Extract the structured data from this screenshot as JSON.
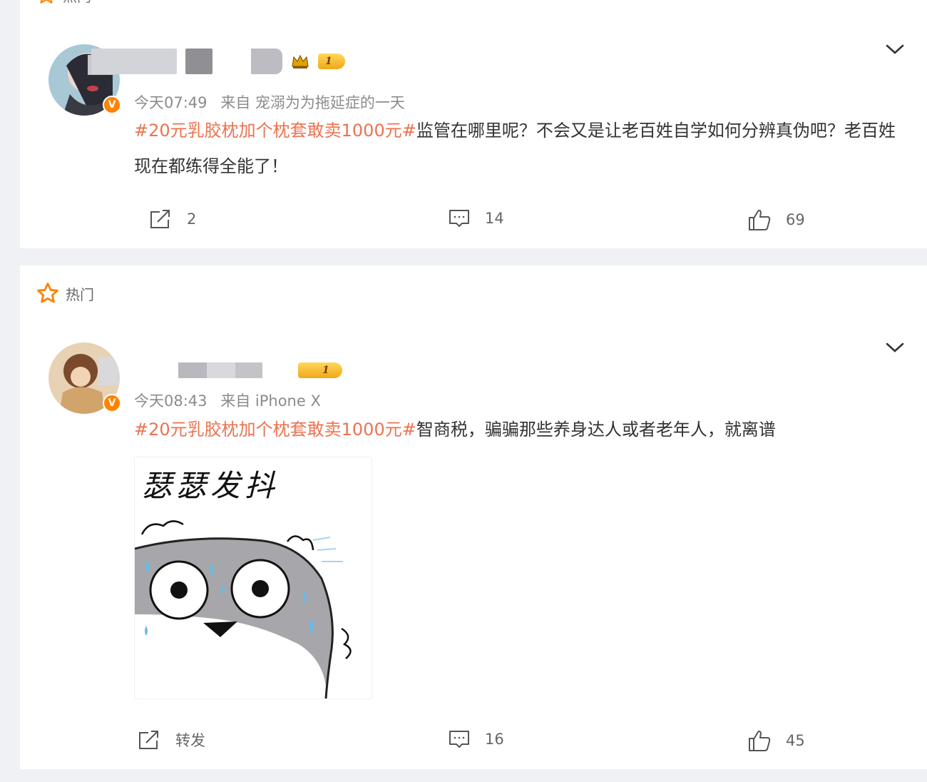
{
  "hot_label": "热门",
  "posts": [
    {
      "time": "今天07:49",
      "source_prefix": "来自",
      "source": "宠溺为为拖延症的一天",
      "level": "1",
      "topic": "#20元乳胶枕加个枕套敢卖1000元#",
      "text": "监管在哪里呢？不会又是让老百姓自学如何分辨真伪吧？老百姓现在都练得全能了！",
      "repost": "2",
      "comments": "14",
      "likes": "69"
    },
    {
      "time": "今天08:43",
      "source_prefix": "来自",
      "source": "iPhone X",
      "level": "1",
      "topic": "#20元乳胶枕加个枕套敢卖1000元#",
      "text": "智商税，骗骗那些养身达人或者老年人，就离谱",
      "image_caption": "瑟瑟发抖",
      "repost": "转发",
      "comments": "16",
      "likes": "45"
    }
  ],
  "icons": {
    "hot": "star-icon",
    "repost": "repost-icon",
    "comment": "comment-icon",
    "like": "thumbs-up-icon",
    "more": "chevron-down-icon",
    "verified": "verified-icon"
  },
  "colors": {
    "topic": "#eb7350",
    "hot_star": "#ff8200",
    "verified": "#ff8200",
    "level_badge": "#f0a818"
  }
}
